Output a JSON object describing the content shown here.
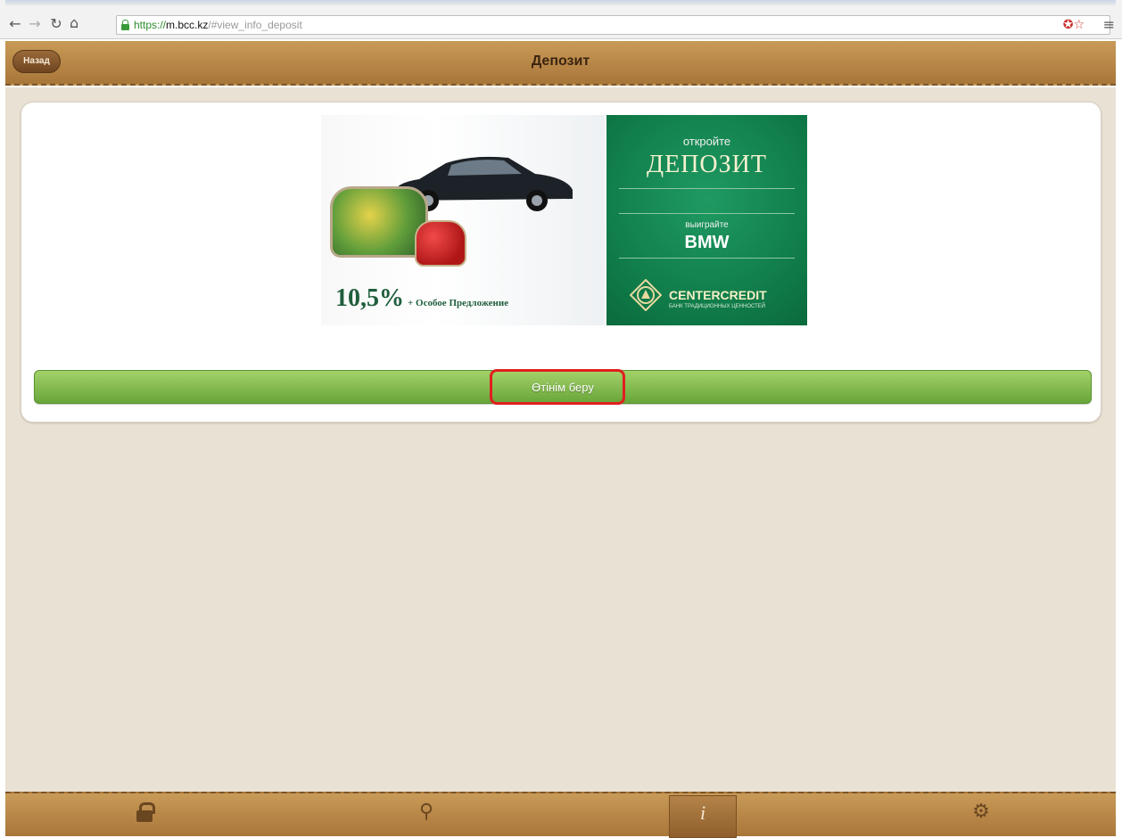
{
  "browser": {
    "url_scheme": "https://",
    "url_host": "m.bcc.kz",
    "url_path": "/#view_info_deposit"
  },
  "header": {
    "back_label": "Назад",
    "title": "Депозит"
  },
  "banner": {
    "open_text": "откройте",
    "deposit_text": "ДЕПОЗИТ",
    "win_text": "выиграйте",
    "prize_text": "BMW",
    "rate_text": "10,5%",
    "offer_text": "+ Особое Предложение",
    "brand_text": "CENTERCREDIT",
    "brand_sub_text": "БАНК ТРАДИЦИОННЫХ ЦЕННОСТЕЙ"
  },
  "action": {
    "label": "Өтінім беру"
  },
  "colors": {
    "header_brown": "#b5854a",
    "banner_green": "#0f7a48",
    "action_green": "#7cb548",
    "highlight_red": "#e01f1f"
  },
  "tabbar": {
    "items": [
      {
        "icon": "lock-icon",
        "active": false
      },
      {
        "icon": "location-pin-icon",
        "active": false
      },
      {
        "icon": "info-icon",
        "active": true
      },
      {
        "icon": "gear-icon",
        "active": false
      }
    ]
  }
}
